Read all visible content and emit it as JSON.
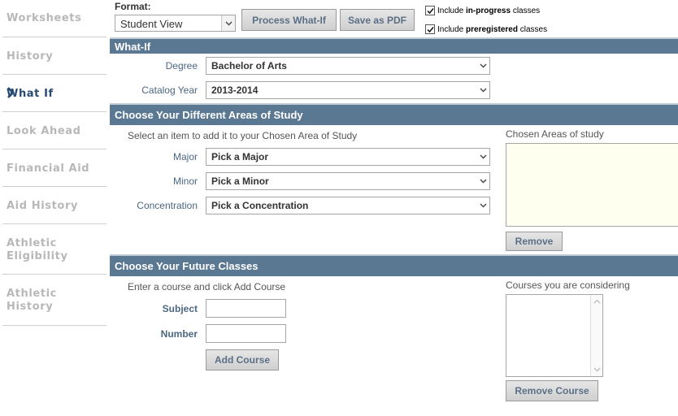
{
  "sidebar": {
    "items": [
      {
        "label": "Worksheets"
      },
      {
        "label": "History"
      },
      {
        "label": "What If",
        "active": true
      },
      {
        "label": "Look Ahead"
      },
      {
        "label": "Financial Aid"
      },
      {
        "label": "Aid History"
      },
      {
        "label": "Athletic",
        "label2": "Eligibility"
      },
      {
        "label": "Athletic",
        "label2": "History"
      }
    ],
    "active_icon": "chevron-right-icon"
  },
  "toolbar": {
    "format_label": "Format:",
    "format_value": "Student View",
    "process_label": "Process What-If",
    "pdf_label": "Save as PDF",
    "inprogress": {
      "prefix": "Include ",
      "bold": "in-progress",
      "suffix": " classes",
      "checked": true
    },
    "preregistered": {
      "prefix": "Include ",
      "bold": "preregistered",
      "suffix": " classes",
      "checked": true
    }
  },
  "whatif": {
    "title": "What-If",
    "degree_label": "Degree",
    "degree_value": "Bachelor of Arts",
    "catalog_label": "Catalog Year",
    "catalog_value": "2013-2014"
  },
  "areas": {
    "title": "Choose Your Different Areas of Study",
    "hint": "Select an item to add it to your Chosen Area of Study",
    "major_label": "Major",
    "major_value": "Pick a Major",
    "minor_label": "Minor",
    "minor_value": "Pick a Minor",
    "concentration_label": "Concentration",
    "concentration_value": "Pick a Concentration",
    "chosen_label": "Chosen Areas of study",
    "remove_label": "Remove"
  },
  "future": {
    "title": "Choose Your Future Classes",
    "hint": "Enter a course and click Add Course",
    "subject_label": "Subject",
    "subject_value": "",
    "number_label": "Number",
    "number_value": "",
    "add_label": "Add Course",
    "considering_label": "Courses you are considering",
    "remove_label": "Remove Course"
  },
  "colors": {
    "section_bar": "#5b7893",
    "active_nav": "#294b73",
    "inactive_nav": "#b8b8b8",
    "field_label": "#4c6782"
  }
}
